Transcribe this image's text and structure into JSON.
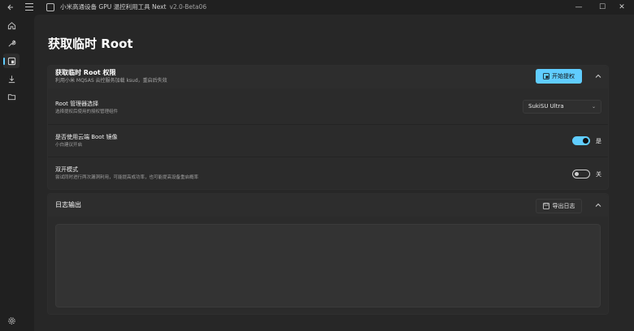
{
  "titlebar": {
    "back_icon": "back-arrow-icon",
    "menu_icon": "hamburger-menu-icon",
    "title": "小米高通设备 GPU 温控利用工具 Next",
    "version": "v2.0-Beta06",
    "minimize": "—",
    "maximize": "☐",
    "close": "✕"
  },
  "nav": {
    "items": [
      {
        "name": "home",
        "icon": "home-icon"
      },
      {
        "name": "tools",
        "icon": "wrench-icon"
      },
      {
        "name": "root",
        "icon": "root-icon",
        "active": true
      },
      {
        "name": "download",
        "icon": "download-icon"
      },
      {
        "name": "folder",
        "icon": "folder-icon"
      }
    ],
    "settings_icon": "gear-icon"
  },
  "page": {
    "title": "获取临时 Root"
  },
  "root_card": {
    "title": "获取临时 Root 权限",
    "subtitle": "利用小米 MQSAS 云控服务加载 ksud，重启后失效",
    "start_button": "开始提权",
    "rows": [
      {
        "title": "Root 管理器选择",
        "subtitle": "选择提权后使用的授权管理组件",
        "select_value": "SukiSU Ultra"
      },
      {
        "title": "是否使用云端 Boot 镜像",
        "subtitle": "小白建议开启",
        "toggle_on": true,
        "toggle_label": "是"
      },
      {
        "title": "双开模式",
        "subtitle": "尝试同时进行两次漏洞利用，可能提高成功率，也可能提高设备重启概率",
        "toggle_on": false,
        "toggle_label": "关"
      }
    ]
  },
  "log_card": {
    "title": "日志输出",
    "export_button": "导出日志"
  },
  "colors": {
    "accent": "#60cdff",
    "background": "#202020",
    "card": "#2b2b2b"
  }
}
